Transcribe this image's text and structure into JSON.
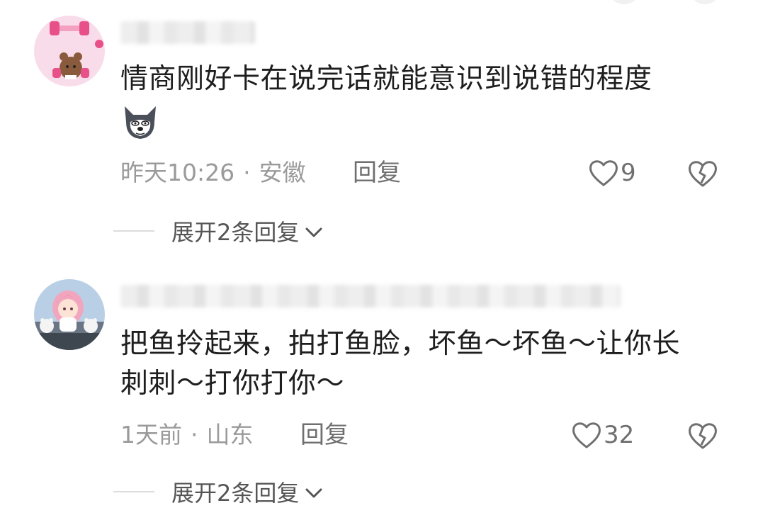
{
  "comments": [
    {
      "text": "情商刚好卡在说完话就能意识到说错的程度",
      "time": "昨天10:26",
      "location": "安徽",
      "reply_label": "回复",
      "like_count": "9",
      "expand_label": "展开2条回复",
      "avatar_icon": "cartoon-bear-avatar",
      "sticker_icon": "husky-dog-emoji"
    },
    {
      "text_line1": "把鱼拎起来，拍打鱼脸，坏鱼～坏鱼～让你长",
      "text_line2": "刺刺～打你打你～",
      "time": "1天前",
      "location": "山东",
      "reply_label": "回复",
      "like_count": "32",
      "expand_label": "展开2条回复",
      "avatar_icon": "pink-hair-girl-avatar"
    }
  ],
  "meta_separator": "·",
  "colors": {
    "text": "#1e1e1e",
    "meta": "#9a9a9a",
    "action": "#6f6f6f"
  }
}
